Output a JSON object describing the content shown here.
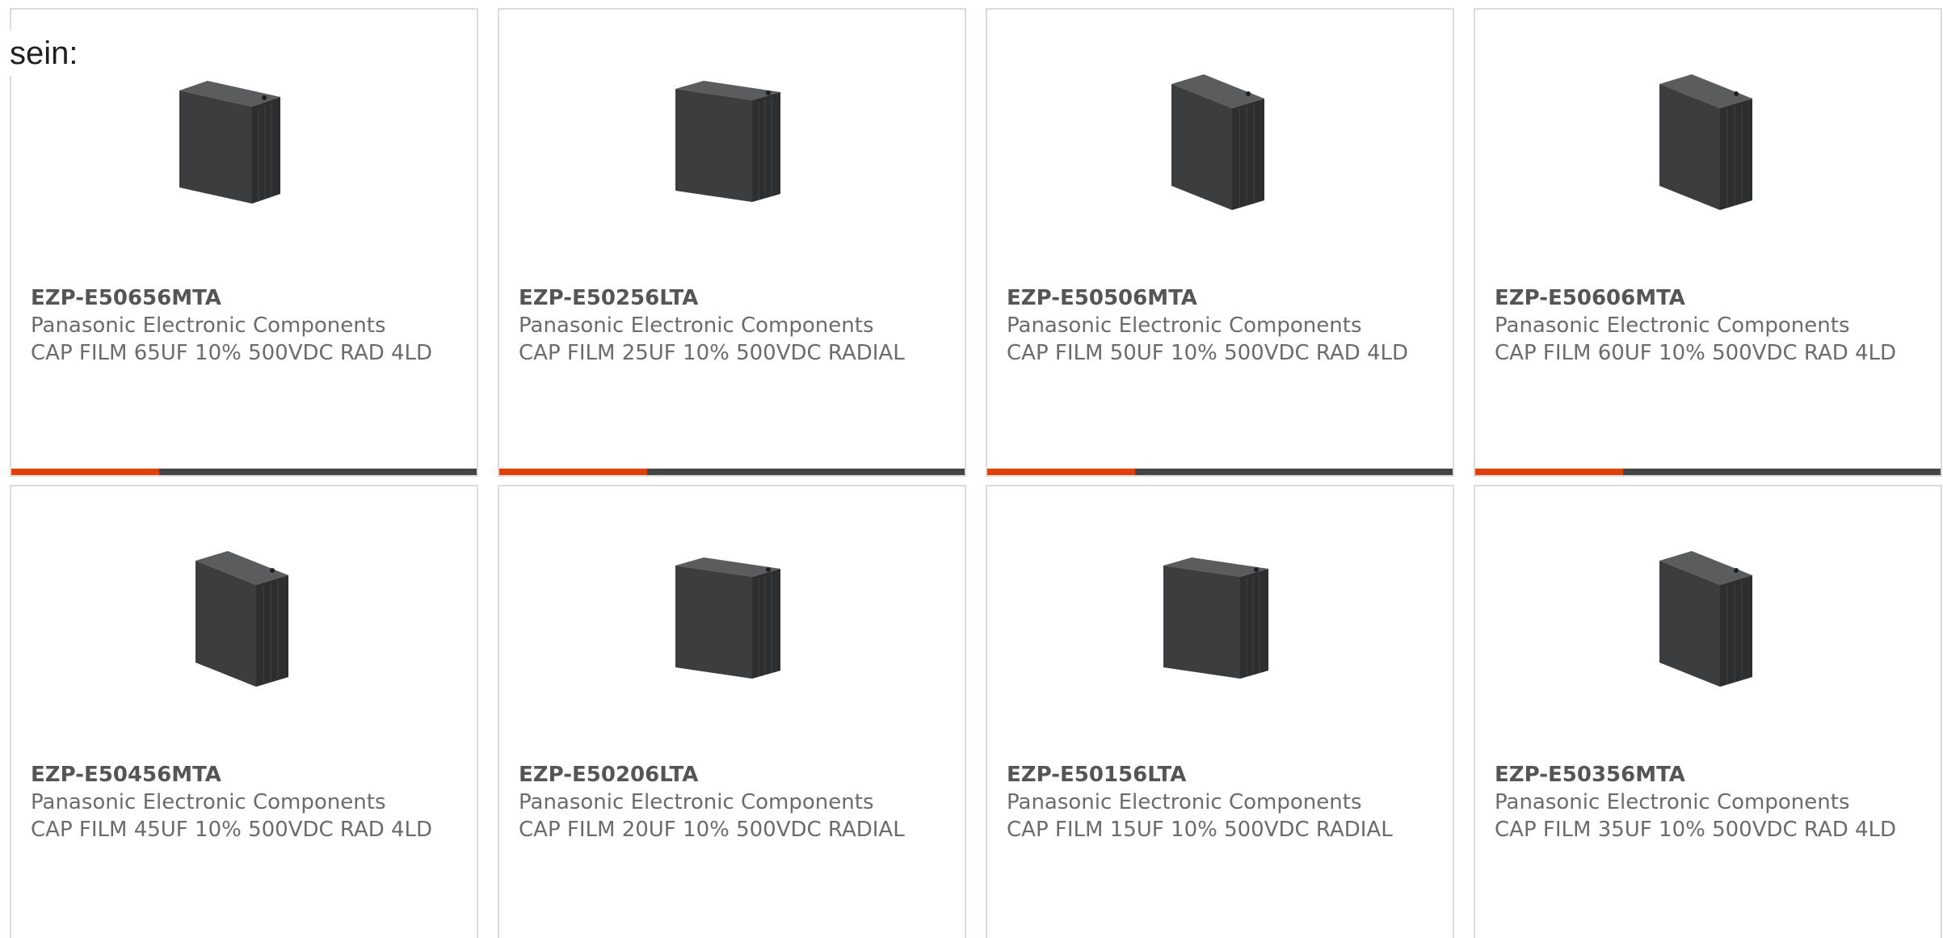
{
  "intro": {
    "text": "sein:"
  },
  "colors": {
    "accent": "#e0400a",
    "bar": "#444444",
    "card_border": "#dcdcdc",
    "text": "#6b6b6b"
  },
  "products": [
    {
      "part_number": "EZP-E50656MTA",
      "manufacturer": "Panasonic Electronic Components",
      "description": "CAP FILM 65UF 10% 500VDC RAD 4LD",
      "image_icon": "film-capacitor-image"
    },
    {
      "part_number": "EZP-E50256LTA",
      "manufacturer": "Panasonic Electronic Components",
      "description": "CAP FILM 25UF 10% 500VDC RADIAL",
      "image_icon": "film-capacitor-image"
    },
    {
      "part_number": "EZP-E50506MTA",
      "manufacturer": "Panasonic Electronic Components",
      "description": "CAP FILM 50UF 10% 500VDC RAD 4LD",
      "image_icon": "film-capacitor-image"
    },
    {
      "part_number": "EZP-E50606MTA",
      "manufacturer": "Panasonic Electronic Components",
      "description": "CAP FILM 60UF 10% 500VDC RAD 4LD",
      "image_icon": "film-capacitor-image"
    },
    {
      "part_number": "EZP-E50456MTA",
      "manufacturer": "Panasonic Electronic Components",
      "description": "CAP FILM 45UF 10% 500VDC RAD 4LD",
      "image_icon": "film-capacitor-image"
    },
    {
      "part_number": "EZP-E50206LTA",
      "manufacturer": "Panasonic Electronic Components",
      "description": "CAP FILM 20UF 10% 500VDC RADIAL",
      "image_icon": "film-capacitor-image"
    },
    {
      "part_number": "EZP-E50156LTA",
      "manufacturer": "Panasonic Electronic Components",
      "description": "CAP FILM 15UF 10% 500VDC RADIAL",
      "image_icon": "film-capacitor-image"
    },
    {
      "part_number": "EZP-E50356MTA",
      "manufacturer": "Panasonic Electronic Components",
      "description": "CAP FILM 35UF 10% 500VDC RAD 4LD",
      "image_icon": "film-capacitor-image"
    }
  ]
}
